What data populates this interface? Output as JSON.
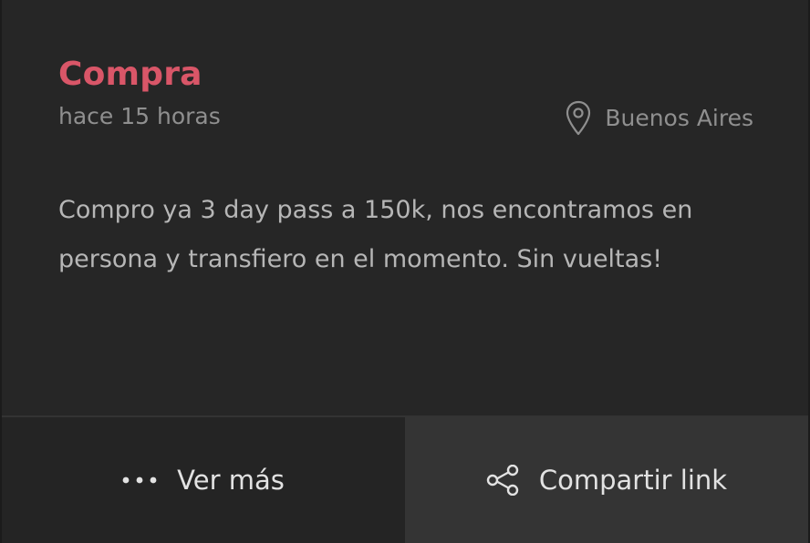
{
  "post": {
    "title": "Compra",
    "time_ago": "hace 15 horas",
    "location": "Buenos Aires",
    "location_icon": "map-pin-icon",
    "description": "Compro ya 3 day pass a 150k, nos encontramos en persona y transfiero en el momento. Sin vueltas!"
  },
  "actions": {
    "more_label": "Ver más",
    "more_icon": "ellipsis-icon",
    "share_label": "Compartir link",
    "share_icon": "share-icon"
  },
  "colors": {
    "accent": "#d95668",
    "card_background": "#262626",
    "muted_text": "#8f8f8f"
  }
}
